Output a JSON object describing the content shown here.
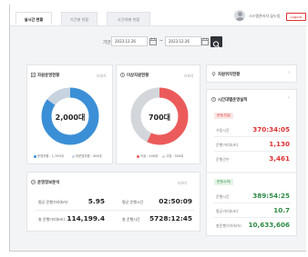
{
  "tabs": [
    {
      "label": "실시간 현황",
      "active": true
    },
    {
      "label": "기간별 현황",
      "active": false
    },
    {
      "label": "시간대별 현황",
      "active": false
    }
  ],
  "header": {
    "user": "시스템관리자 꿈누림",
    "logout": "Logout"
  },
  "filter": {
    "label": "기간",
    "start_date": "2023.12.26",
    "end_date": "2023.12.26",
    "separator": "~"
  },
  "left_card": {
    "title": "자원운영현황",
    "more": "더보기",
    "value_label": "2,000대",
    "legend": [
      "운영자원 : 1,700대",
      "미운영자원 : 300대"
    ],
    "colors": {
      "primary": "#3b8fd6",
      "secondary": "#c7d3df"
    },
    "chart_data": {
      "type": "pie",
      "values": [
        1700,
        300
      ],
      "total": 2000
    }
  },
  "mid_card": {
    "title": "이상자원현황",
    "more": "더보기",
    "value_label": "700대",
    "legend": [
      "이상 : 400대",
      "고장 : 300대"
    ],
    "colors": {
      "primary": "#ec5b5b",
      "secondary": "#d3d6db"
    },
    "chart_data": {
      "type": "pie",
      "values": [
        400,
        300
      ],
      "total": 700
    }
  },
  "operation_card": {
    "title": "운영정보분석",
    "more": "더보기",
    "rows": [
      {
        "label": "평균 운행거리(km)",
        "value": "5.95"
      },
      {
        "label": "평균 운행시간",
        "value": "02:50:09"
      },
      {
        "label": "총 운행거리(km)",
        "value": "114,199.4"
      },
      {
        "label": "총 운행시간",
        "value": "5728:12:45"
      }
    ]
  },
  "right_top": {
    "title": "자원위치현황"
  },
  "right_main": {
    "title": "시간대별운영실적",
    "sections": [
      {
        "badge": "운영(전일)",
        "color": "red",
        "rows": [
          {
            "label": "가동시간",
            "value": "370:34:05"
          },
          {
            "label": "운행거리(km)",
            "value": "1,130"
          },
          {
            "label": "운행건수",
            "value": "3,461"
          }
        ]
      },
      {
        "badge": "운영(누적)",
        "color": "green",
        "rows": [
          {
            "label": "운행시간",
            "value": "389:54:25"
          },
          {
            "label": "평균거리(km)",
            "value": "10.7"
          },
          {
            "label": "총운행거리(km)",
            "value": "10,633,606"
          }
        ]
      }
    ]
  }
}
